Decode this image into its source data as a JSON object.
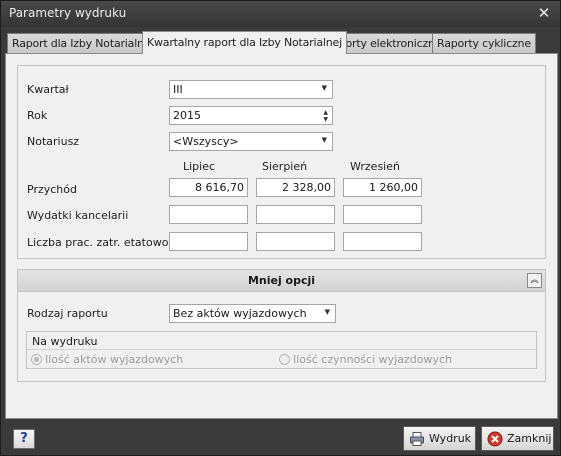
{
  "window": {
    "title": "Parametry wydruku",
    "close_glyph": "✕"
  },
  "tabs": [
    {
      "label": "Raport dla Izby Notarialnej"
    },
    {
      "label": "Kwartalny raport dla Izby Notarialnej"
    },
    {
      "label": "Raporty elektroniczne"
    },
    {
      "label": "Raporty cykliczne"
    }
  ],
  "form": {
    "kwartal_label": "Kwartał",
    "kwartal_value": "III",
    "rok_label": "Rok",
    "rok_value": "2015",
    "notariusz_label": "Notariusz",
    "notariusz_value": "<Wszyscy>",
    "months": [
      "Lipiec",
      "Sierpień",
      "Wrzesień"
    ],
    "rows": [
      {
        "label": "Przychód",
        "values": [
          "8 616,70",
          "2 328,00",
          "1 260,00"
        ]
      },
      {
        "label": "Wydatki kancelarii",
        "values": [
          "",
          "",
          ""
        ]
      },
      {
        "label": "Liczba prac. zatr. etatowo",
        "values": [
          "",
          "",
          ""
        ]
      }
    ]
  },
  "section": {
    "title": "Mniej opcji",
    "rodzaj_label": "Rodzaj raportu",
    "rodzaj_value": "Bez aktów wyjazdowych",
    "na_wydruku_label": "Na wydruku",
    "radio_acts": "Ilość aktów wyjazdowych",
    "radio_actions": "Ilość czynności wyjazdowych",
    "selected_radio": "acts"
  },
  "footer": {
    "help_label": "?",
    "print_label": "Wydruk",
    "close_label": "Zamknij"
  },
  "icons": {
    "close": "close-icon",
    "dropdown": "chevron-down-icon",
    "collapse": "double-chevron-up-icon",
    "help": "help-icon",
    "print": "printer-icon",
    "cancel": "cancel-icon"
  }
}
